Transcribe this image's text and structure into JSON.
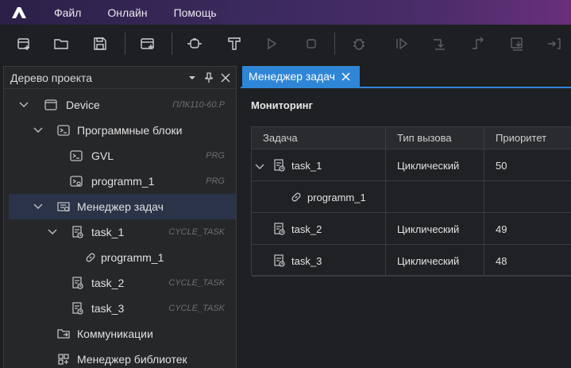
{
  "menubar": {
    "items": [
      "Файл",
      "Онлайн",
      "Помощь"
    ]
  },
  "toolbar": {
    "buttons": [
      "add-file",
      "open-folder",
      "save",
      "add-object",
      "connect",
      "compile",
      "run",
      "stop",
      "debug",
      "step-into",
      "step-over",
      "step-out",
      "run-to-cursor",
      "exit"
    ]
  },
  "project_tree": {
    "title": "Дерево проекта",
    "items": [
      {
        "label": "Device",
        "tag": "ПЛК110-60.Р"
      },
      {
        "label": "Программные блоки",
        "tag": ""
      },
      {
        "label": "GVL",
        "tag": "PRG"
      },
      {
        "label": "programm_1",
        "tag": "PRG"
      },
      {
        "label": "Менеджер задач",
        "tag": ""
      },
      {
        "label": "task_1",
        "tag": "CYCLE_TASK"
      },
      {
        "label": "programm_1",
        "tag": ""
      },
      {
        "label": "task_2",
        "tag": "CYCLE_TASK"
      },
      {
        "label": "task_3",
        "tag": "CYCLE_TASK"
      },
      {
        "label": "Коммуникации",
        "tag": ""
      },
      {
        "label": "Менеджер библиотек",
        "tag": ""
      }
    ]
  },
  "editor": {
    "tab_label": "Менеджер задач",
    "section_title": "Мониторинг",
    "columns": [
      "Задача",
      "Тип вызова",
      "Приоритет"
    ],
    "rows": [
      {
        "task": "task_1",
        "call_type": "Циклический",
        "priority": "50"
      },
      {
        "task": "programm_1",
        "call_type": "",
        "priority": ""
      },
      {
        "task": "task_2",
        "call_type": "Циклический",
        "priority": "49"
      },
      {
        "task": "task_3",
        "call_type": "Циклический",
        "priority": "48"
      }
    ]
  },
  "colors": {
    "accent": "#2f86d6",
    "selection": "#2a3347",
    "menubar_start": "#2b2047",
    "menubar_end": "#6a2f7a"
  }
}
